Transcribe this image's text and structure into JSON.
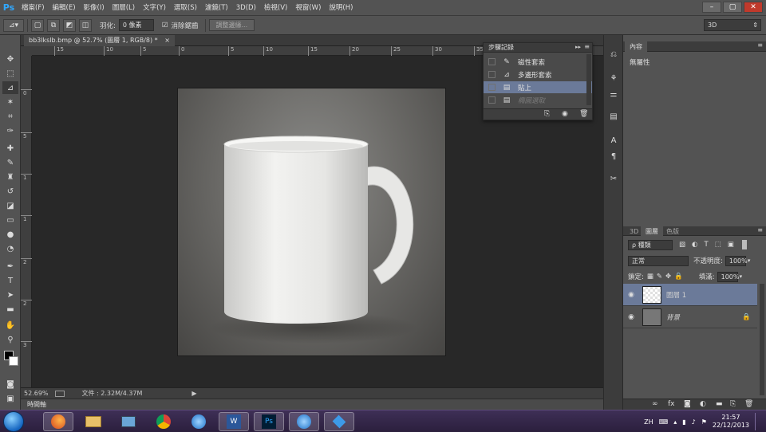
{
  "app": {
    "logo": "Ps"
  },
  "menus": [
    "檔案(F)",
    "編輯(E)",
    "影像(I)",
    "圖層(L)",
    "文字(Y)",
    "選取(S)",
    "濾鏡(T)",
    "3D(D)",
    "檢視(V)",
    "視窗(W)",
    "說明(H)"
  ],
  "window_controls": [
    "–",
    "▢",
    "✕"
  ],
  "options": {
    "feather_label": "羽化:",
    "feather_value": "0 像素",
    "antialias_label": "消除鋸齒",
    "refine_edge_label": "調整邊緣...",
    "workspace": "3D"
  },
  "document": {
    "tab_title": "bb3lkslb.bmp @ 52.7% (圖層 1, RGB/8) *",
    "zoom": "52.69%",
    "file_info": "文件 : 2.32M/4.37M"
  },
  "rulers": {
    "h_labels": [
      "15",
      "10",
      "5",
      "0",
      "5",
      "10",
      "15",
      "20",
      "25",
      "30",
      "35"
    ],
    "v_labels": [
      "0",
      "5",
      "1",
      "1",
      "2",
      "2",
      "3"
    ]
  },
  "timeline_label": "時間軸",
  "history": {
    "title": "步驟記錄",
    "items": [
      {
        "label": "磁性套索",
        "icon": "✎",
        "state": "normal"
      },
      {
        "label": "多邊形套索",
        "icon": "⊿",
        "state": "normal"
      },
      {
        "label": "貼上",
        "icon": "▤",
        "state": "selected"
      },
      {
        "label": "橢圓選取",
        "icon": "▤",
        "state": "dim"
      }
    ]
  },
  "properties": {
    "tab": "內容",
    "body": "無屬性"
  },
  "layers_panel": {
    "tabs": [
      "3D",
      "圖層",
      "色版"
    ],
    "filter": "ρ 種類",
    "blend_mode": "正常",
    "opacity_label": "不透明度:",
    "opacity_value": "100%",
    "lock_label": "鎖定:",
    "fill_label": "填滿:",
    "fill_value": "100%",
    "layers": [
      {
        "name": "圖層 1",
        "selected": true
      },
      {
        "name": "背景",
        "selected": false
      }
    ]
  },
  "taskbar": {
    "lang": "ZH",
    "time": "21:57",
    "date": "22/12/2013"
  }
}
